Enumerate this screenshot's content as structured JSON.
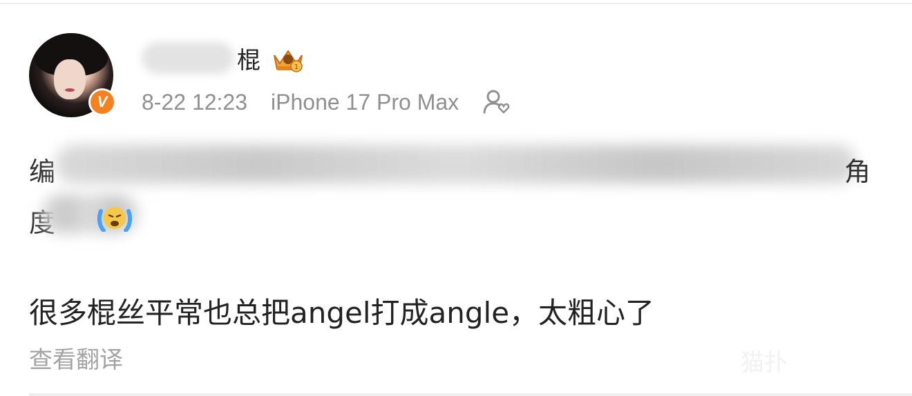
{
  "post": {
    "author": {
      "name_visible_char": "棍",
      "verified_badge": "V",
      "badge_icon": "crown-icon",
      "accent_color": "#f58220"
    },
    "meta": {
      "timestamp": "8-22 12:23",
      "device": "iPhone 17 Pro Max",
      "follow_icon": "person-heart-icon"
    },
    "content": {
      "line1_start": "编",
      "line1_end": "角",
      "line2_start": "度",
      "emoji_icon": "crying-face-icon",
      "main_text": "很多棍丝平常也总把angel打成angle，太粗心了"
    },
    "translate_label": "查看翻译",
    "watermark": "猫扑"
  }
}
